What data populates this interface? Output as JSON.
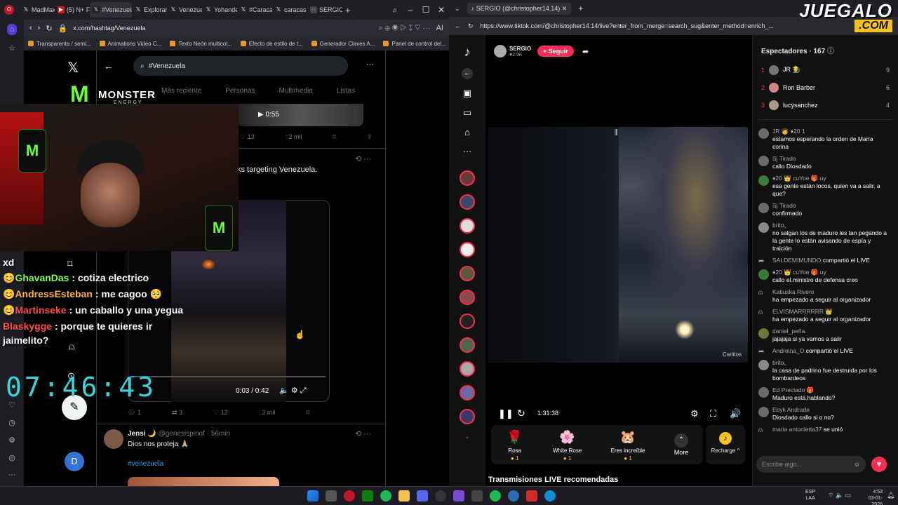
{
  "left_browser": {
    "tabs": [
      {
        "label": "MadMax"
      },
      {
        "label": "(5) N+ F"
      },
      {
        "label": "#Venezuela"
      },
      {
        "label": "Explorar"
      },
      {
        "label": "Venezue"
      },
      {
        "label": "Yohander"
      },
      {
        "label": "#Caracas"
      },
      {
        "label": "caracas"
      },
      {
        "label": "SERGIO"
      }
    ],
    "url": "x.com/hashtag/Venezuela",
    "bookmarks": [
      "Transparenta / semi...",
      "Animations Video C...",
      "Texto Neón multicol...",
      "Efecto de estilo de t...",
      "Generador Claves A...",
      "Panel de control del..."
    ]
  },
  "x_page": {
    "search_value": "#Venezuela",
    "tabs": [
      "Más reciente",
      "Personas",
      "Multimedia",
      "Listas"
    ],
    "post1": {
      "video_time": "0:55",
      "likes": "13",
      "views": "2 mil"
    },
    "post2": {
      "text": "ks targeting Venezuela.",
      "video_time": "0:03 / 0:42",
      "replies": "1",
      "reposts": "3",
      "likes": "12",
      "views": "3 mil"
    },
    "post3": {
      "name": "Jensi 🌙",
      "handle": "@genesispinof · 56min",
      "text": "Dios nos proteja 🙏🏼",
      "hashtag": "#venezuela"
    },
    "avatar_letter": "D"
  },
  "overlay": {
    "brand": "MONSTER",
    "brand_sub": "ENERGY",
    "chat": [
      {
        "user": "",
        "msg": "xd"
      },
      {
        "user": "GhavanDas",
        "msg": ": cotiza electrico",
        "color": "#7cff4a"
      },
      {
        "user": "AndressEsteban",
        "msg": ": me cagoo 🥺",
        "color": "#ffb43a"
      },
      {
        "user": "Martinseke",
        "msg": ": un caballo y una yegua",
        "color": "#ff4a4a"
      },
      {
        "user": "Blaskygge",
        "msg": ": porque te quieres ir",
        "color": "#ff4a4a"
      },
      {
        "user": "",
        "msg": "jaimelito?"
      }
    ],
    "clock": "07:46:43"
  },
  "right_browser": {
    "tab": "SERGIO (@christopher14.14)",
    "url": "https://www.tiktok.com/@christopher14.14/live?enter_from_merge=search_sug&enter_method=enrich_...",
    "watermark": "JUEGALO",
    "watermark_sub": ".COM"
  },
  "tiktok": {
    "host": "SERGIO",
    "host_likes": "♥2.9K",
    "follow": "+ Seguir",
    "duration": "1:31:38",
    "video_label": "Carlitos",
    "gifts": [
      {
        "name": "Rosa",
        "price": "1",
        "icon": "🌹"
      },
      {
        "name": "White Rose",
        "price": "1",
        "icon": "🌸"
      },
      {
        "name": "Eres increíble",
        "price": "1",
        "icon": "🐹"
      }
    ],
    "more": "More",
    "recharge": "Recharge ^",
    "recommended": "Transmisiones LIVE recomendadas",
    "viewers_title": "Espectadores · 167",
    "viewers": [
      {
        "rank": "1",
        "name": "JR 🧑‍🌾",
        "score": "9"
      },
      {
        "rank": "2",
        "name": "Ron Barber",
        "score": "6"
      },
      {
        "rank": "3",
        "name": "lucysanchez",
        "score": "4"
      }
    ],
    "messages": [
      {
        "user": "JR 🧑 ♦20 1",
        "text": "estamos esperando la orden de María corina"
      },
      {
        "user": "Sj Tirado",
        "text": "callo Diosdado"
      },
      {
        "user": "♦20 👑 cuYoe 🎁 uy",
        "text": "esa gente están locos, quien va a salir. a que?"
      },
      {
        "user": "Sj Tirado",
        "text": "confirmado"
      },
      {
        "user": "brito◟",
        "text": "no salgan los de maduro les tan pegando a la gente lo están avisando de espía y traición"
      },
      {
        "user": "SALDEMIMUNDO",
        "text": "compartió el LIVE"
      },
      {
        "user": "♦20 👑 cuYoe 🎁 uy",
        "text": "callo el.ministro de defensa creo"
      },
      {
        "user": "Katiuska Rivero",
        "text": "ha empezado a seguir al organizador"
      },
      {
        "user": "ELVISMARRRRRR 👑",
        "text": "ha empezado a seguir al organizador"
      },
      {
        "user": "daniel_peña.",
        "text": "jajajaja si ya vamos a salir"
      },
      {
        "user": "Andreina_O",
        "text": "compartió el LIVE"
      },
      {
        "user": "brito◟",
        "text": "la casa de padrino fue destruida por los bombardeos"
      },
      {
        "user": "Ed Preciado 🎁",
        "text": "Maduro está hablando?"
      },
      {
        "user": "Ebyk Andrade",
        "text": "Diosdado callo si o no?"
      },
      {
        "user": "maria antonietta37",
        "text": "se unió"
      }
    ],
    "input_placeholder": "Escribe algo..."
  },
  "taskbar": {
    "lang": "ESP",
    "lang2": "LAA",
    "time": "4:53",
    "date": "03-01-2026"
  }
}
